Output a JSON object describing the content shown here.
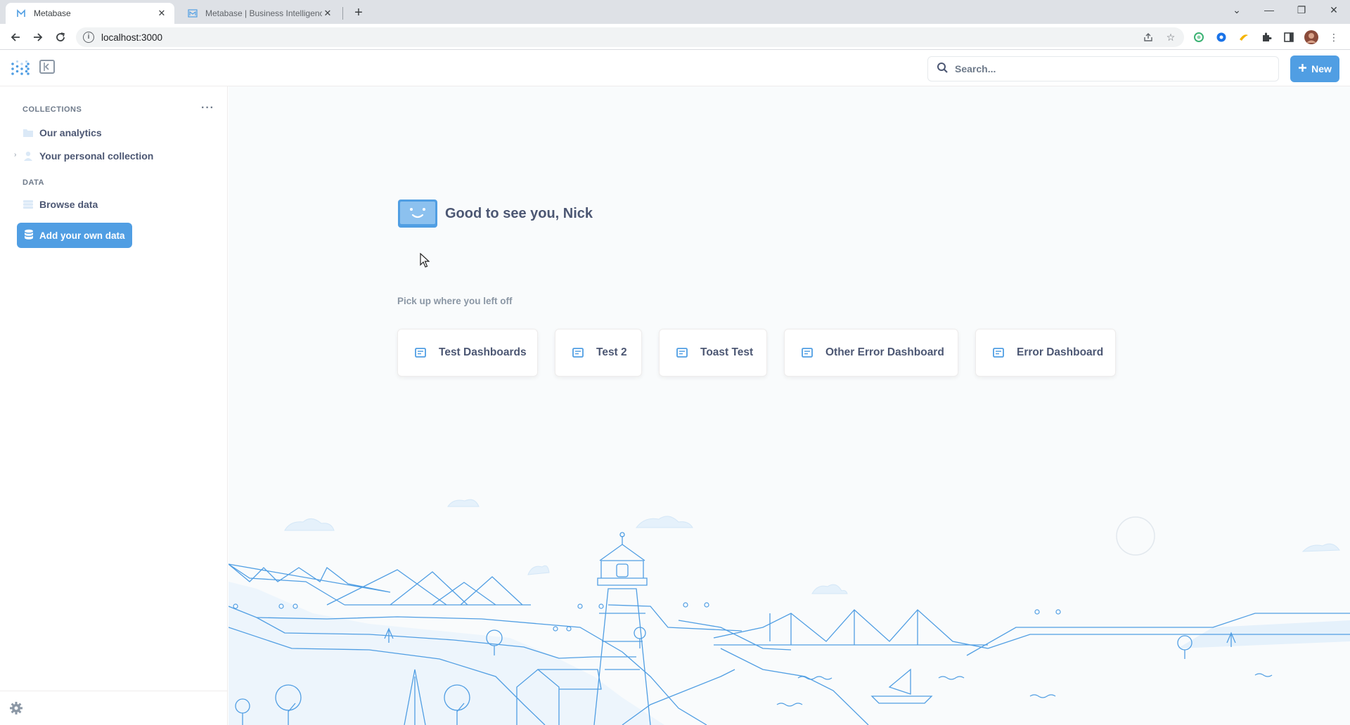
{
  "browser": {
    "tabs": [
      {
        "title": "Metabase",
        "active": true
      },
      {
        "title": "Metabase | Business Intelligence",
        "active": false
      }
    ],
    "url": "localhost:3000"
  },
  "header": {
    "search_placeholder": "Search...",
    "new_button_label": "New"
  },
  "sidebar": {
    "collections_label": "COLLECTIONS",
    "collections": [
      {
        "label": "Our analytics",
        "icon": "folder-icon"
      },
      {
        "label": "Your personal collection",
        "icon": "person-icon"
      }
    ],
    "data_label": "DATA",
    "browse_data_label": "Browse data",
    "add_data_label": "Add your own data"
  },
  "main": {
    "greeting": "Good to see you, Nick",
    "pickup_label": "Pick up where you left off",
    "recent_items": [
      {
        "label": "Test Dashboards",
        "icon": "dashboard-icon"
      },
      {
        "label": "Test 2",
        "icon": "dashboard-icon"
      },
      {
        "label": "Toast Test",
        "icon": "dashboard-icon"
      },
      {
        "label": "Other Error Dashboard",
        "icon": "dashboard-icon"
      },
      {
        "label": "Error Dashboard",
        "icon": "dashboard-icon"
      }
    ]
  },
  "colors": {
    "brand": "#509ee3",
    "text_dark": "#4c5773",
    "text_medium": "#8b97a5",
    "background": "#f9fbfc",
    "illustration_line": "#509ee3",
    "illustration_fill": "#e5f1fb"
  }
}
